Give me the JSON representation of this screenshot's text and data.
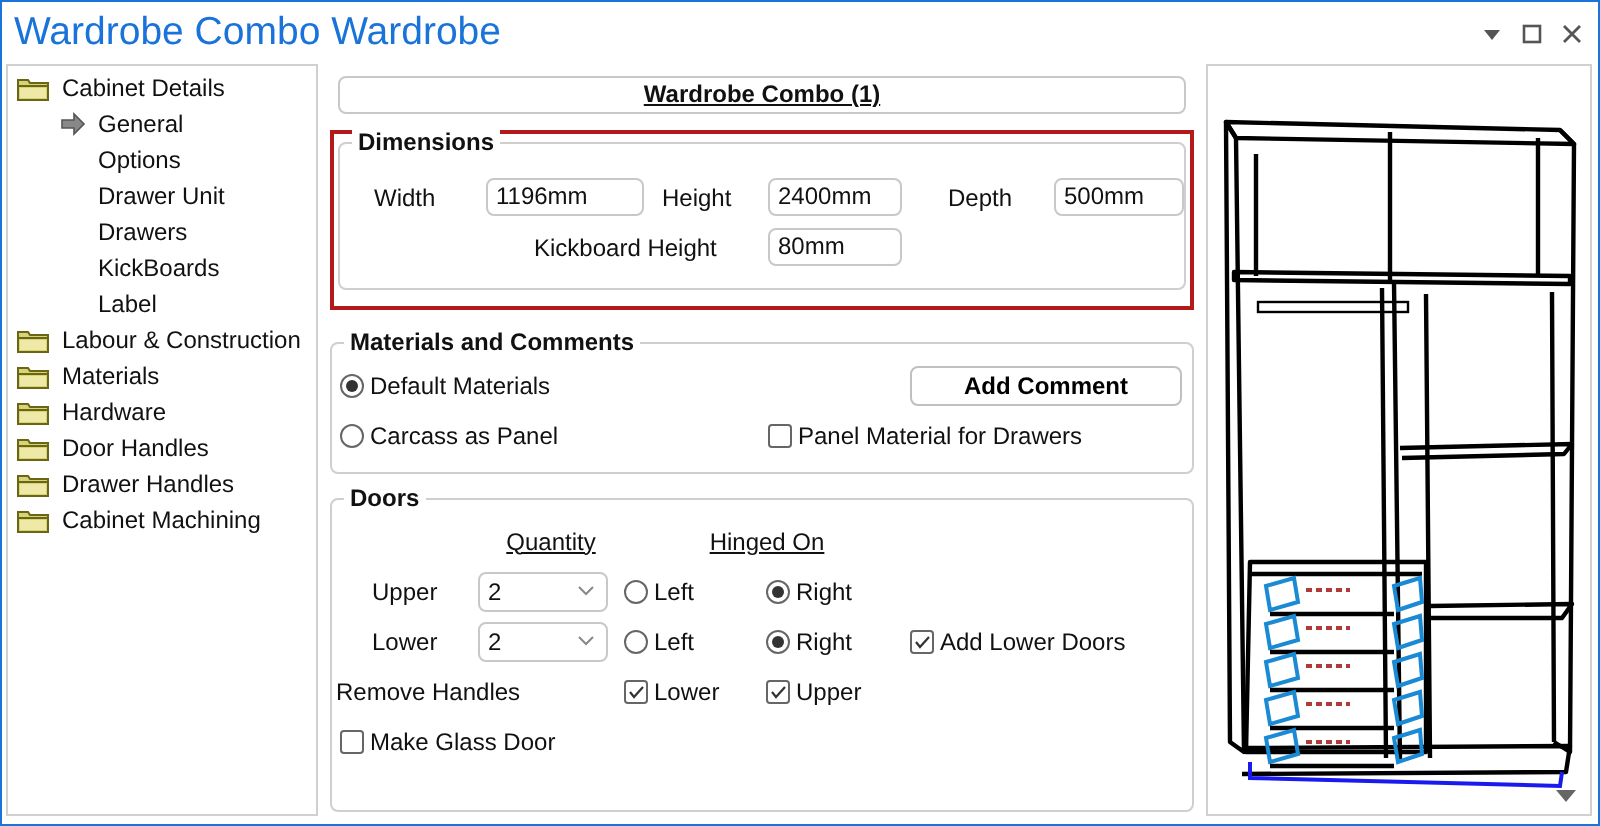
{
  "window": {
    "title": "Wardrobe Combo Wardrobe"
  },
  "tree": [
    {
      "label": "Cabinet Details",
      "kind": "folder",
      "selected": false,
      "children": [
        {
          "label": "General",
          "kind": "page",
          "selected": true
        },
        {
          "label": "Options",
          "kind": "page",
          "selected": false
        },
        {
          "label": "Drawer Unit",
          "kind": "page",
          "selected": false
        },
        {
          "label": "Drawers",
          "kind": "page",
          "selected": false
        },
        {
          "label": "KickBoards",
          "kind": "page",
          "selected": false
        },
        {
          "label": "Label",
          "kind": "page",
          "selected": false
        }
      ]
    },
    {
      "label": "Labour & Construction",
      "kind": "folder",
      "selected": false
    },
    {
      "label": "Materials",
      "kind": "folder",
      "selected": false
    },
    {
      "label": "Hardware",
      "kind": "folder",
      "selected": false
    },
    {
      "label": "Door Handles",
      "kind": "folder",
      "selected": false
    },
    {
      "label": "Drawer Handles",
      "kind": "folder",
      "selected": false
    },
    {
      "label": "Cabinet Machining",
      "kind": "folder",
      "selected": false
    }
  ],
  "header": "Wardrobe Combo (1)",
  "dimensions": {
    "title": "Dimensions",
    "fields": [
      {
        "label": "Width",
        "value": "1196mm"
      },
      {
        "label": "Height",
        "value": "2400mm"
      },
      {
        "label": "Depth",
        "value": "500mm"
      }
    ],
    "kickboard": {
      "label": "Kickboard Height",
      "value": "80mm"
    }
  },
  "materials": {
    "title": "Materials and Comments",
    "options": [
      {
        "label": "Default Materials",
        "selected": true
      },
      {
        "label": "Carcass as Panel",
        "selected": false
      }
    ],
    "button": "Add Comment",
    "panel_material": {
      "label": "Panel Material for Drawers",
      "checked": false
    }
  },
  "doors": {
    "title": "Doors",
    "quantity_heading": "Quantity",
    "hinged_heading": "Hinged On",
    "rows": [
      {
        "label": "Upper",
        "quantity": "2",
        "left": {
          "label": "Left",
          "selected": false
        },
        "right": {
          "label": "Right",
          "selected": true
        }
      },
      {
        "label": "Lower",
        "quantity": "2",
        "left": {
          "label": "Left",
          "selected": false
        },
        "right": {
          "label": "Right",
          "selected": true
        },
        "extra": {
          "label": "Add Lower Doors",
          "checked": true
        }
      }
    ],
    "remove_handles": {
      "label": "Remove Handles",
      "options": [
        {
          "label": "Lower",
          "checked": true
        },
        {
          "label": "Upper",
          "checked": true
        }
      ]
    },
    "glass_door": {
      "label": "Make Glass Door",
      "checked": false
    }
  }
}
